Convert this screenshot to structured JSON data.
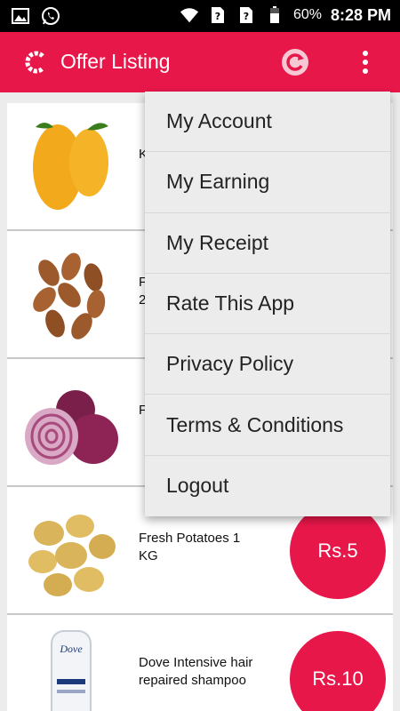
{
  "status_bar": {
    "battery_percent": "60%",
    "time": "8:28 PM",
    "icons": [
      "image-icon",
      "whatsapp-icon",
      "wifi-icon",
      "sim1-icon",
      "sim2-icon",
      "battery-icon"
    ]
  },
  "app_bar": {
    "title": "Offer Listing",
    "icons": [
      "app-logo-icon",
      "refresh-icon",
      "more-vert-icon"
    ]
  },
  "colors": {
    "accent": "#e8174a",
    "menu_bg": "#ececec"
  },
  "offers": [
    {
      "name": "K",
      "price": "",
      "image": "mango"
    },
    {
      "name": "F\n2",
      "price": "",
      "image": "almonds"
    },
    {
      "name": "F",
      "price": "",
      "image": "onions"
    },
    {
      "name": "Fresh Potatoes 1 KG",
      "price": "Rs.5",
      "image": "potatoes"
    },
    {
      "name": "Dove Intensive hair repaired shampoo",
      "price": "Rs.10",
      "image": "shampoo"
    }
  ],
  "menu": {
    "items": [
      "My Account",
      "My Earning",
      "My Receipt",
      "Rate This App",
      "Privacy Policy",
      "Terms & Conditions",
      "Logout"
    ]
  }
}
